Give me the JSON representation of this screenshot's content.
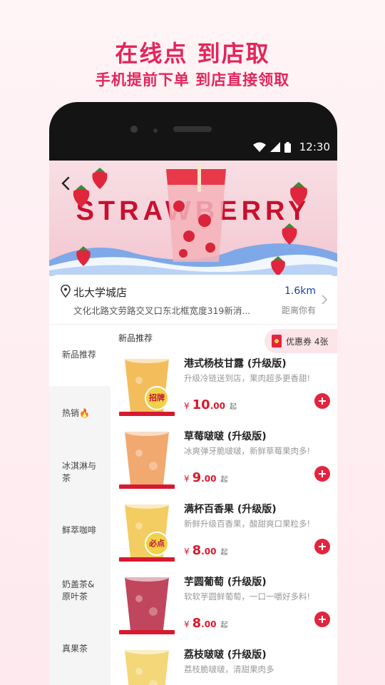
{
  "promo": {
    "headline": "在线点 到店取",
    "subline": "手机提前下单  到店直接领取"
  },
  "statusbar": {
    "time": "12:30"
  },
  "banner": {
    "word": "STRAWBERRY"
  },
  "store": {
    "name": "北大学城店",
    "address": "文化北路文劳路交叉口东北框宽度319新消...",
    "distance": "1.6km",
    "distance_label": "距离你有"
  },
  "sidebar": {
    "items": [
      {
        "label": "新品推荐"
      },
      {
        "label": "热销🔥"
      },
      {
        "label": "冰淇淋与\n茶"
      },
      {
        "label": "鲜萃咖啡"
      },
      {
        "label": "奶盖茶&\n原叶茶"
      },
      {
        "label": "真果茶"
      }
    ]
  },
  "section": {
    "title": "新品推荐",
    "coupon": "优惠券 4张"
  },
  "products": [
    {
      "name": "港式杨枝甘露 (升级版)",
      "desc": "升级冷链送到店，果肉超多更香甜!",
      "currency": "¥",
      "price_int": "10",
      "price_dec": ".00",
      "suffix": "起",
      "badge": "招牌",
      "color": "#f2b64a"
    },
    {
      "name": "草莓啵啵 (升级版)",
      "desc": "冰爽弹牙脆啵啵，新鲜草莓果肉多!",
      "currency": "¥",
      "price_int": "9",
      "price_dec": ".00",
      "suffix": "起",
      "badge": "",
      "color": "#f0a060"
    },
    {
      "name": "满杯百香果 (升级版)",
      "desc": "新鲜升级百香果，酸甜爽口果粒多!",
      "currency": "¥",
      "price_int": "8",
      "price_dec": ".00",
      "suffix": "起",
      "badge": "必点",
      "color": "#f2c850"
    },
    {
      "name": "芋圆葡萄 (升级版)",
      "desc": "软软芋圆鲜葡萄，一口一嚼好多料!",
      "currency": "¥",
      "price_int": "8",
      "price_dec": ".00",
      "suffix": "起",
      "badge": "",
      "color": "#b8324a"
    },
    {
      "name": "荔枝啵啵 (升级版)",
      "desc": "荔枝脆啵啵，清甜果肉多",
      "currency": "¥",
      "price_int": "",
      "price_dec": "",
      "suffix": "",
      "badge": "",
      "color": "#f2d36a"
    }
  ]
}
